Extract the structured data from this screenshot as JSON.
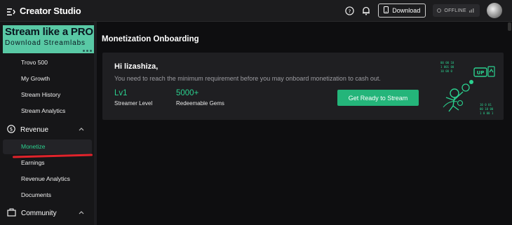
{
  "app": {
    "title": "Creator Studio",
    "brand_icon": "creator-studio-logo-icon"
  },
  "topbar": {
    "help_icon": "question-circle-icon",
    "notifications_icon": "bell-icon",
    "download_label": "Download",
    "download_icon": "device-icon",
    "status_text": "OFFLINE",
    "status_icon": "broadcast-status-icon"
  },
  "sidebar": {
    "promo": {
      "title": "Stream like a PRO",
      "subtitle": "Download Streamlabs",
      "bg_color": "#59c9a5"
    },
    "items": [
      {
        "label": "Trovo 500"
      },
      {
        "label": "My Growth"
      },
      {
        "label": "Stream History"
      },
      {
        "label": "Stream Analytics"
      }
    ],
    "revenue": {
      "label": "Revenue",
      "icon": "dollar-circle-icon",
      "items": [
        {
          "label": "Monetize",
          "active": true
        },
        {
          "label": "Earnings"
        },
        {
          "label": "Revenue Analytics"
        },
        {
          "label": "Documents"
        }
      ]
    },
    "community": {
      "label": "Community",
      "icon": "community-icon"
    }
  },
  "main": {
    "title": "Monetization Onboarding",
    "card": {
      "greeting": "Hi lizashiza,",
      "requirement_text": "You need to reach the minimum requirement before you may onboard monetization to cash out.",
      "stats": [
        {
          "value": "Lv1",
          "label": "Streamer Level"
        },
        {
          "value": "5000+",
          "label": "Redeemable Gems"
        }
      ],
      "cta_label": "Get Ready to Stream",
      "illustration_badge": "UP",
      "illustration_bits": [
        "00 00 10",
        "1 001 00",
        "10 00 0",
        "10 0 01",
        "00 10 00",
        "1 0 00 1"
      ]
    }
  },
  "colors": {
    "accent": "#2bd18f",
    "button": "#24b57a",
    "annotation_red": "#e0232b"
  }
}
